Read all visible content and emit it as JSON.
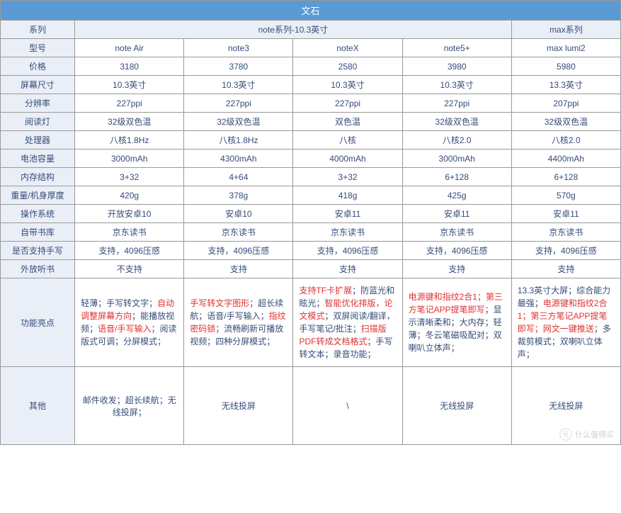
{
  "title": "文石",
  "seriesHeaders": {
    "note": "note系列-10.3英寸",
    "max": "max系列"
  },
  "rowLabels": {
    "model": "型号",
    "price": "价格",
    "screen": "屏幕尺寸",
    "ppi": "分辨率",
    "light": "阅读灯",
    "cpu": "处理器",
    "battery": "电池容量",
    "storage": "内存结构",
    "weight": "重量/机身厚度",
    "os": "操作系统",
    "store": "自带书库",
    "pen": "是否支持手写",
    "tts": "外放听书",
    "feat": "功能亮点",
    "other": "其他"
  },
  "cols": [
    "noteAir",
    "note3",
    "noteX",
    "note5p",
    "maxlumi2"
  ],
  "data": {
    "model": {
      "noteAir": "note Air",
      "note3": "note3",
      "noteX": "noteX",
      "note5p": "note5+",
      "maxlumi2": "max lumi2"
    },
    "price": {
      "noteAir": "3180",
      "note3": "3780",
      "noteX": "2580",
      "note5p": "3980",
      "maxlumi2": "5980"
    },
    "screen": {
      "noteAir": "10.3英寸",
      "note3": "10.3英寸",
      "noteX": "10.3英寸",
      "note5p": "10.3英寸",
      "maxlumi2": "13.3英寸"
    },
    "ppi": {
      "noteAir": "227ppi",
      "note3": "227ppi",
      "noteX": "227ppi",
      "note5p": "227ppi",
      "maxlumi2": "207ppi"
    },
    "light": {
      "noteAir": "32级双色温",
      "note3": "32级双色温",
      "noteX": "双色温",
      "note5p": "32级双色温",
      "maxlumi2": "32级双色温"
    },
    "cpu": {
      "noteAir": "八核1.8Hz",
      "note3": "八核1.8Hz",
      "noteX": "八核",
      "note5p": "八核2.0",
      "maxlumi2": "八核2.0"
    },
    "battery": {
      "noteAir": "3000mAh",
      "note3": "4300mAh",
      "noteX": "4000mAh",
      "note5p": "3000mAh",
      "maxlumi2": "4400mAh"
    },
    "storage": {
      "noteAir": "3+32",
      "note3": "4+64",
      "noteX": "3+32",
      "note5p": "6+128",
      "maxlumi2": "6+128"
    },
    "weight": {
      "noteAir": "420g",
      "note3": "378g",
      "noteX": "418g",
      "note5p": "425g",
      "maxlumi2": "570g"
    },
    "os": {
      "noteAir": "开放安卓10",
      "note3": "安卓10",
      "noteX": "安卓11",
      "note5p": "安卓11",
      "maxlumi2": "安卓11"
    },
    "store": {
      "noteAir": "京东读书",
      "note3": "京东读书",
      "noteX": "京东读书",
      "note5p": "京东读书",
      "maxlumi2": "京东读书"
    },
    "pen": {
      "noteAir": "支持，4096压感",
      "note3": "支持，4096压感",
      "noteX": "支持，4096压感",
      "note5p": "支持，4096压感",
      "maxlumi2": "支持，4096压感"
    },
    "tts": {
      "noteAir": "不支持",
      "note3": "支持",
      "noteX": "支持",
      "note5p": "支持",
      "maxlumi2": "支持"
    },
    "other": {
      "noteAir": "邮件收发；超长续航；无线投屏；",
      "note3": "无线投屏",
      "noteX": "\\",
      "note5p": "无线投屏",
      "maxlumi2": "无线投屏"
    }
  },
  "feat": {
    "noteAir": [
      {
        "t": "轻薄；手写转文字；"
      },
      {
        "t": "自动调整屏幕方向",
        "r": 1
      },
      {
        "t": "；能播放视频；"
      },
      {
        "t": "语音/手写输入",
        "r": 1
      },
      {
        "t": "；阅读版式可调；分屏模式；"
      }
    ],
    "note3": [
      {
        "t": "手写转文字图形",
        "r": 1
      },
      {
        "t": "；超长续航；语音/手写输入；"
      },
      {
        "t": "指纹密码锁",
        "r": 1
      },
      {
        "t": "；流畅刷新可播放视频；四种分屏模式；"
      }
    ],
    "noteX": [
      {
        "t": "支持TF卡扩展",
        "r": 1
      },
      {
        "t": "；防蓝光和眩光；"
      },
      {
        "t": "智能优化排版，论文模式",
        "r": 1
      },
      {
        "t": "；双屏阅读/翻译，手写笔记/批注；"
      },
      {
        "t": "扫描版PDF转成文档格式",
        "r": 1
      },
      {
        "t": "；手写转文本；录音功能；"
      }
    ],
    "note5p": [
      {
        "t": "电源键和指纹2合1；第三方笔记APP提笔即写",
        "r": 1
      },
      {
        "t": "；显示清晰柔和；大内存；轻薄；冬云笔磁吸配对；双喇叭立体声；"
      }
    ],
    "maxlumi2": [
      {
        "t": "13.3英寸大屏；综合能力最强；"
      },
      {
        "t": "电源键和指纹2合1；第三方笔记APP提笔即写；网文一键推送",
        "r": 1
      },
      {
        "t": "；多裁剪模式；双喇叭立体声；"
      }
    ]
  },
  "watermark": "什么值得买"
}
